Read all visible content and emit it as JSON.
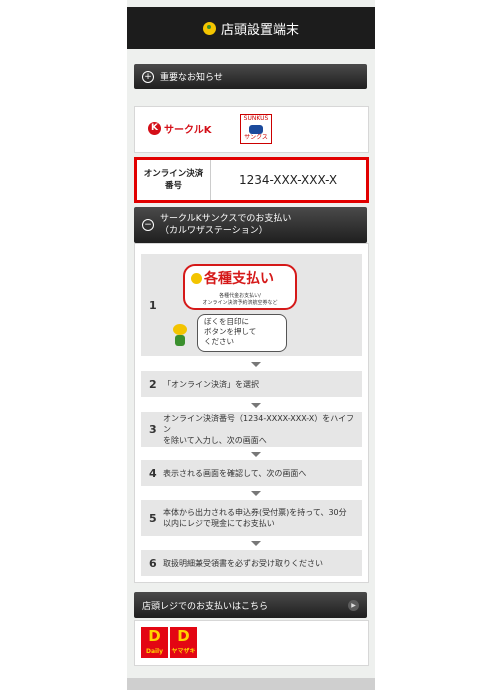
{
  "header": {
    "title": "店頭設置端末"
  },
  "notice_bar": {
    "icon": "+",
    "label": "重要なお知らせ"
  },
  "logos": {
    "circle_k": "サークルK",
    "circle_k_mark": "K",
    "sunkus": "SUNKUS",
    "sunkus_sub": "サンクス"
  },
  "payment_number": {
    "label_line1": "オンライン決済",
    "label_line2": "番号",
    "value": "1234-XXX-XXX-X"
  },
  "section": {
    "icon": "−",
    "title_line1": "サークルKサンクスでのお支払い",
    "title_line2": "（カルワザステーション）"
  },
  "step1": {
    "num": "1",
    "banner_title": "各種支払い",
    "banner_sub1": "各種代金お支払い/",
    "banner_sub2": "オンライン決済予約済航空券など",
    "bubble_line1": "ぼくを目印に",
    "bubble_line2": "ボタンを押して",
    "bubble_line3": "ください"
  },
  "steps": [
    {
      "num": "2",
      "line1": "「オンライン決済」を選択",
      "line2": ""
    },
    {
      "num": "3",
      "line1": "オンライン決済番号（1234-XXXX-XXX-X）をハイフン",
      "line2": "を除いて入力し、次の画面へ"
    },
    {
      "num": "4",
      "line1": "表示される画面を確認して、次の画面へ",
      "line2": ""
    },
    {
      "num": "5",
      "line1": "本体から出力される申込券(受付票)を持って、30分",
      "line2": "以内にレジで現金にてお支払い"
    },
    {
      "num": "6",
      "line1": "取扱明細兼受領書を必ずお受け取りください",
      "line2": ""
    }
  ],
  "register_bar": {
    "label": "店頭レジでのお支払いはこちら",
    "arrow": "▶"
  },
  "bottom_logos": [
    {
      "mark": "D",
      "text": "Daily"
    },
    {
      "mark": "D",
      "text": "ヤマザキ"
    }
  ]
}
